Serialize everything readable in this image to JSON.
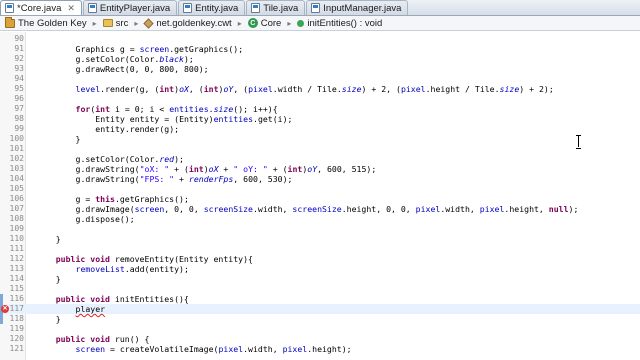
{
  "tabs": [
    {
      "label": "*Core.java",
      "active": true
    },
    {
      "label": "EntityPlayer.java",
      "active": false
    },
    {
      "label": "Entity.java",
      "active": false
    },
    {
      "label": "Tile.java",
      "active": false
    },
    {
      "label": "InputManager.java",
      "active": false
    }
  ],
  "breadcrumb": {
    "project": "The Golden Key",
    "folder": "src",
    "package": "net.goldenkey.cwt",
    "class": "Core",
    "method": "initEntities() : void"
  },
  "editor": {
    "current_line": 117,
    "error_line": 117,
    "lines": [
      {
        "n": "90",
        "code": ""
      },
      {
        "n": "91",
        "code": "Graphics g = screen.getGraphics();"
      },
      {
        "n": "92",
        "code": "g.setColor(Color.black);"
      },
      {
        "n": "93",
        "code": "g.drawRect(0, 0, 800, 800);"
      },
      {
        "n": "94",
        "code": ""
      },
      {
        "n": "95",
        "code": "level.render(g, (int)oX, (int)oY, (pixel.width / Tile.size) + 2, (pixel.height / Tile.size) + 2);"
      },
      {
        "n": "96",
        "code": ""
      },
      {
        "n": "97",
        "code": "for(int i = 0; i < entities.size(); i++){"
      },
      {
        "n": "98",
        "code": "Entity entity = (Entity)entities.get(i);"
      },
      {
        "n": "99",
        "code": "entity.render(g);"
      },
      {
        "n": "100",
        "code": "}"
      },
      {
        "n": "101",
        "code": ""
      },
      {
        "n": "102",
        "code": "g.setColor(Color.red);"
      },
      {
        "n": "103",
        "code": "g.drawString(\"oX: \" + (int)oX + \" oY: \" + (int)oY, 600, 515);"
      },
      {
        "n": "104",
        "code": "g.drawString(\"FPS: \" + renderFps, 600, 530);"
      },
      {
        "n": "105",
        "code": ""
      },
      {
        "n": "106",
        "code": "g = this.getGraphics();"
      },
      {
        "n": "107",
        "code": "g.drawImage(screen, 0, 0, screenSize.width, screenSize.height, 0, 0, pixel.width, pixel.height, null);"
      },
      {
        "n": "108",
        "code": "g.dispose();"
      },
      {
        "n": "109",
        "code": ""
      },
      {
        "n": "110",
        "code": "}"
      },
      {
        "n": "111",
        "code": ""
      },
      {
        "n": "112",
        "code": "public void removeEntity(Entity entity){"
      },
      {
        "n": "113",
        "code": "removeList.add(entity);"
      },
      {
        "n": "114",
        "code": "}"
      },
      {
        "n": "115",
        "code": ""
      },
      {
        "n": "116",
        "code": "public void initEntities(){"
      },
      {
        "n": "117",
        "code": "player"
      },
      {
        "n": "118",
        "code": "}"
      },
      {
        "n": "119",
        "code": ""
      },
      {
        "n": "120",
        "code": "public void run() {"
      },
      {
        "n": "121",
        "code": "screen = createVolatileImage(pixel.width, pixel.height);"
      }
    ]
  }
}
